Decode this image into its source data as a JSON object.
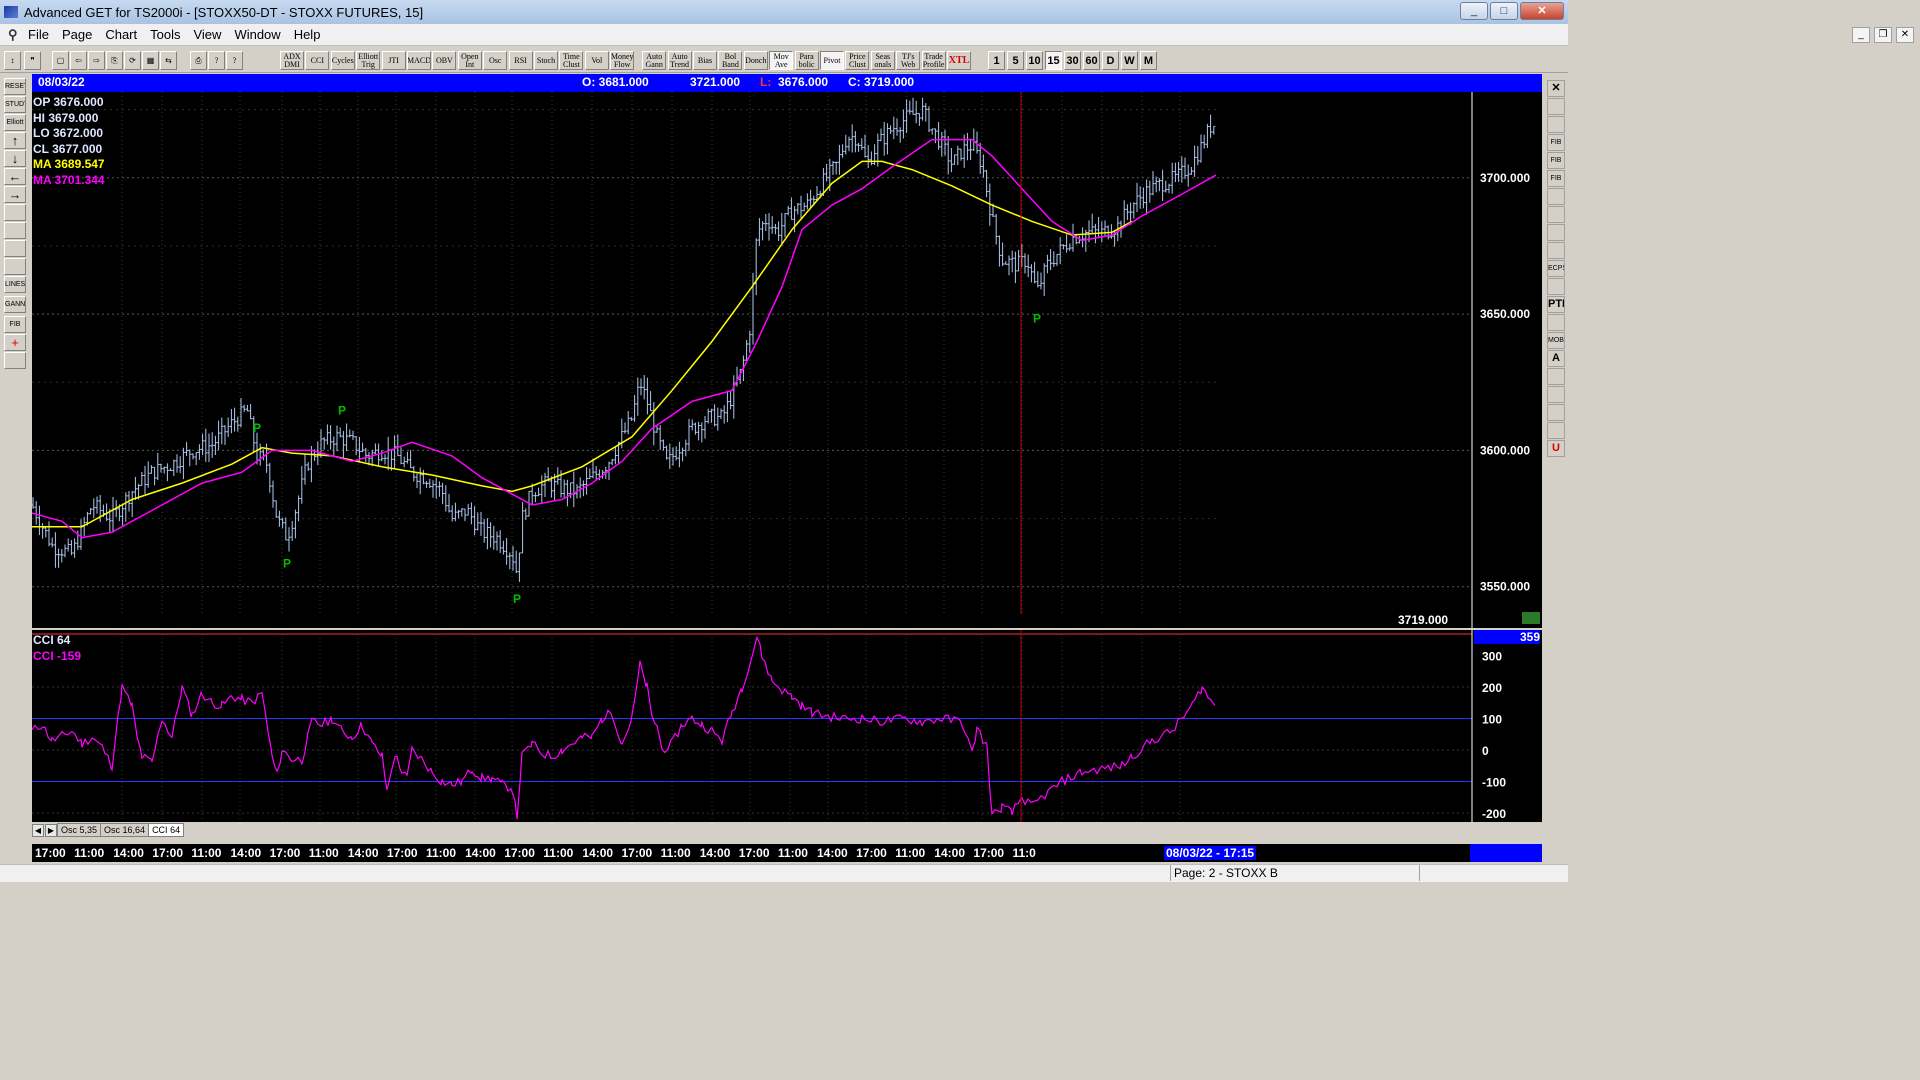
{
  "window": {
    "title": "Advanced GET for TS2000i - [STOXX50-DT - STOXX FUTURES, 15]",
    "minimize": "_",
    "maximize": "□",
    "close": "✕"
  },
  "menu": [
    "File",
    "Page",
    "Chart",
    "Tools",
    "View",
    "Window",
    "Help"
  ],
  "toolbar": {
    "study_buttons": [
      "ADX DMI",
      "CCI",
      "Cycles",
      "Elliott Trig",
      "JTI",
      "MACD",
      "OBV",
      "Open Int",
      "Osc",
      "RSI",
      "Stoch",
      "Time Clust",
      "Vol",
      "Money Flow",
      "Auto Gann",
      "Auto Trend",
      "Bias",
      "Bol Band",
      "Donch",
      "Mov Ave",
      "Para bolic",
      "Pivot",
      "Price Clust",
      "Seas onals",
      "TJ's Web",
      "Trade Profile",
      "XTL"
    ],
    "intervals": [
      "1",
      "5",
      "10",
      "15",
      "30",
      "60",
      "D",
      "W",
      "M"
    ],
    "active_interval": "15"
  },
  "left_tools": [
    "RESET",
    "STUDY",
    "Elliott",
    "↑",
    "↓",
    "←",
    "→",
    "",
    "",
    "",
    "",
    "LINES",
    "GANN",
    "FIB",
    "+",
    ""
  ],
  "right_tools": [
    "✕",
    "",
    "",
    "FIB RET",
    "FIB EXT",
    "FIB TIME",
    "",
    "",
    "",
    "",
    "ECPS",
    "",
    "PTI",
    "",
    "MOB",
    "A",
    "",
    "",
    "",
    "",
    "U"
  ],
  "header": {
    "date": "08/03/22",
    "open": "O: 3681.000",
    "high": "3721.000",
    "low_label": "L:",
    "low": "3676.000",
    "close": "C: 3719.000"
  },
  "cursor_info": {
    "op": "OP  3676.000",
    "hi": "HI   3679.000",
    "lo": "LO   3672.000",
    "cl": "CL   3677.000",
    "ma1": "MA  3689.547",
    "ma2": "MA  3701.344"
  },
  "price_axis": {
    "ticks": [
      "3700.000",
      "3650.000",
      "3600.000",
      "3550.000"
    ],
    "last_price": "3719.000"
  },
  "oscillator": {
    "title": "CCI 64",
    "value_label": "CCI  -159",
    "ticks": [
      "300",
      "200",
      "100",
      "0",
      "-100",
      "-200"
    ],
    "current": "359"
  },
  "pivot_label": "P",
  "osc_tabs": [
    "Osc 5,35",
    "Osc 16,64",
    "CCI 64"
  ],
  "time_axis": [
    "17:00",
    "11:00",
    "14:00",
    "17:00",
    "11:00",
    "14:00",
    "17:00",
    "11:00",
    "14:00",
    "17:00",
    "11:00",
    "14:00",
    "17:00",
    "11:00",
    "14:00",
    "17:00",
    "11:00",
    "14:00",
    "17:00",
    "11:00",
    "14:00",
    "17:00",
    "11:00",
    "14:00",
    "17:00",
    "11:0"
  ],
  "time_cursor": "08/03/22 - 17:15",
  "status": "Page: 2 - STOXX B",
  "colors": {
    "price_bars": "#b0c8f0",
    "ma_fast": "#ffff00",
    "ma_slow": "#ff00ff",
    "pivot": "#00c000",
    "cursor_line": "#c00000",
    "header_bar": "#0000ff"
  },
  "chart_data": {
    "type": "line",
    "title": "STOXX50-DT - STOXX FUTURES, 15",
    "y_range": [
      3540,
      3730
    ],
    "price_path": [
      [
        0,
        3580
      ],
      [
        20,
        3565
      ],
      [
        40,
        3562
      ],
      [
        60,
        3580
      ],
      [
        80,
        3575
      ],
      [
        100,
        3585
      ],
      [
        120,
        3592
      ],
      [
        140,
        3595
      ],
      [
        160,
        3600
      ],
      [
        180,
        3602
      ],
      [
        200,
        3610
      ],
      [
        215,
        3615
      ],
      [
        225,
        3598
      ],
      [
        235,
        3595
      ],
      [
        245,
        3575
      ],
      [
        255,
        3568
      ],
      [
        265,
        3580
      ],
      [
        275,
        3595
      ],
      [
        290,
        3603
      ],
      [
        305,
        3605
      ],
      [
        320,
        3603
      ],
      [
        335,
        3598
      ],
      [
        350,
        3600
      ],
      [
        365,
        3598
      ],
      [
        380,
        3592
      ],
      [
        395,
        3590
      ],
      [
        410,
        3585
      ],
      [
        420,
        3575
      ],
      [
        435,
        3578
      ],
      [
        450,
        3570
      ],
      [
        465,
        3568
      ],
      [
        480,
        3562
      ],
      [
        485,
        3555
      ],
      [
        490,
        3575
      ],
      [
        500,
        3585
      ],
      [
        515,
        3588
      ],
      [
        530,
        3586
      ],
      [
        545,
        3585
      ],
      [
        560,
        3590
      ],
      [
        575,
        3595
      ],
      [
        590,
        3605
      ],
      [
        600,
        3612
      ],
      [
        608,
        3625
      ],
      [
        615,
        3618
      ],
      [
        625,
        3605
      ],
      [
        635,
        3595
      ],
      [
        645,
        3600
      ],
      [
        660,
        3608
      ],
      [
        675,
        3612
      ],
      [
        690,
        3612
      ],
      [
        700,
        3620
      ],
      [
        710,
        3630
      ],
      [
        718,
        3645
      ],
      [
        725,
        3680
      ],
      [
        735,
        3685
      ],
      [
        745,
        3680
      ],
      [
        760,
        3688
      ],
      [
        775,
        3690
      ],
      [
        790,
        3698
      ],
      [
        805,
        3705
      ],
      [
        815,
        3715
      ],
      [
        825,
        3715
      ],
      [
        835,
        3705
      ],
      [
        845,
        3712
      ],
      [
        860,
        3718
      ],
      [
        875,
        3722
      ],
      [
        890,
        3725
      ],
      [
        900,
        3718
      ],
      [
        910,
        3712
      ],
      [
        920,
        3705
      ],
      [
        930,
        3710
      ],
      [
        940,
        3712
      ],
      [
        950,
        3705
      ],
      [
        960,
        3685
      ],
      [
        970,
        3670
      ],
      [
        985,
        3668
      ],
      [
        995,
        3670
      ],
      [
        1005,
        3658
      ],
      [
        1015,
        3668
      ],
      [
        1025,
        3672
      ],
      [
        1040,
        3678
      ],
      [
        1055,
        3680
      ],
      [
        1070,
        3680
      ],
      [
        1085,
        3682
      ],
      [
        1100,
        3690
      ],
      [
        1115,
        3695
      ],
      [
        1130,
        3698
      ],
      [
        1145,
        3700
      ],
      [
        1160,
        3705
      ],
      [
        1170,
        3712
      ],
      [
        1180,
        3720
      ],
      [
        1184,
        3719
      ]
    ],
    "ma_fast": [
      [
        0,
        3572
      ],
      [
        50,
        3572
      ],
      [
        100,
        3582
      ],
      [
        150,
        3588
      ],
      [
        200,
        3595
      ],
      [
        230,
        3601
      ],
      [
        260,
        3599
      ],
      [
        300,
        3598
      ],
      [
        350,
        3594
      ],
      [
        400,
        3591
      ],
      [
        450,
        3587
      ],
      [
        480,
        3585
      ],
      [
        500,
        3587
      ],
      [
        550,
        3594
      ],
      [
        600,
        3605
      ],
      [
        640,
        3622
      ],
      [
        680,
        3640
      ],
      [
        720,
        3660
      ],
      [
        760,
        3681
      ],
      [
        800,
        3698
      ],
      [
        830,
        3706
      ],
      [
        850,
        3706
      ],
      [
        880,
        3703
      ],
      [
        920,
        3697
      ],
      [
        960,
        3690
      ],
      [
        1000,
        3684
      ],
      [
        1040,
        3679
      ],
      [
        1080,
        3680
      ],
      [
        1100,
        3684
      ]
    ],
    "ma_slow": [
      [
        0,
        3577
      ],
      [
        30,
        3574
      ],
      [
        50,
        3568
      ],
      [
        80,
        3570
      ],
      [
        120,
        3578
      ],
      [
        170,
        3588
      ],
      [
        210,
        3592
      ],
      [
        240,
        3600
      ],
      [
        280,
        3600
      ],
      [
        320,
        3596
      ],
      [
        350,
        3599
      ],
      [
        380,
        3603
      ],
      [
        420,
        3598
      ],
      [
        450,
        3590
      ],
      [
        480,
        3584
      ],
      [
        500,
        3580
      ],
      [
        530,
        3582
      ],
      [
        560,
        3588
      ],
      [
        590,
        3596
      ],
      [
        620,
        3608
      ],
      [
        660,
        3618
      ],
      [
        700,
        3622
      ],
      [
        725,
        3640
      ],
      [
        750,
        3660
      ],
      [
        770,
        3681
      ],
      [
        800,
        3690
      ],
      [
        830,
        3696
      ],
      [
        860,
        3704
      ],
      [
        900,
        3714
      ],
      [
        940,
        3714
      ],
      [
        960,
        3708
      ],
      [
        990,
        3696
      ],
      [
        1020,
        3684
      ],
      [
        1050,
        3677
      ],
      [
        1080,
        3679
      ],
      [
        1110,
        3686
      ],
      [
        1150,
        3694
      ],
      [
        1184,
        3701
      ]
    ],
    "cci": [
      [
        0,
        60
      ],
      [
        10,
        80
      ],
      [
        20,
        30
      ],
      [
        30,
        45
      ],
      [
        40,
        60
      ],
      [
        50,
        20
      ],
      [
        60,
        40
      ],
      [
        70,
        10
      ],
      [
        80,
        -50
      ],
      [
        90,
        200
      ],
      [
        100,
        140
      ],
      [
        105,
        40
      ],
      [
        110,
        -20
      ],
      [
        120,
        -40
      ],
      [
        130,
        100
      ],
      [
        140,
        40
      ],
      [
        150,
        200
      ],
      [
        160,
        110
      ],
      [
        170,
        180
      ],
      [
        180,
        150
      ],
      [
        190,
        140
      ],
      [
        200,
        170
      ],
      [
        210,
        160
      ],
      [
        220,
        150
      ],
      [
        230,
        180
      ],
      [
        240,
        -20
      ],
      [
        245,
        -80
      ],
      [
        250,
        0
      ],
      [
        260,
        -30
      ],
      [
        270,
        -30
      ],
      [
        280,
        90
      ],
      [
        290,
        80
      ],
      [
        300,
        100
      ],
      [
        310,
        60
      ],
      [
        320,
        40
      ],
      [
        330,
        80
      ],
      [
        340,
        20
      ],
      [
        350,
        -20
      ],
      [
        355,
        -130
      ],
      [
        360,
        -50
      ],
      [
        365,
        -20
      ],
      [
        370,
        -70
      ],
      [
        375,
        -90
      ],
      [
        380,
        0
      ],
      [
        390,
        -30
      ],
      [
        400,
        -70
      ],
      [
        410,
        -100
      ],
      [
        420,
        -110
      ],
      [
        430,
        -100
      ],
      [
        440,
        -60
      ],
      [
        450,
        -90
      ],
      [
        460,
        -90
      ],
      [
        470,
        -110
      ],
      [
        480,
        -120
      ],
      [
        485,
        -210
      ],
      [
        490,
        -20
      ],
      [
        500,
        20
      ],
      [
        510,
        -10
      ],
      [
        520,
        -20
      ],
      [
        530,
        0
      ],
      [
        540,
        20
      ],
      [
        550,
        40
      ],
      [
        560,
        40
      ],
      [
        570,
        100
      ],
      [
        580,
        120
      ],
      [
        590,
        20
      ],
      [
        600,
        100
      ],
      [
        608,
        270
      ],
      [
        615,
        200
      ],
      [
        620,
        100
      ],
      [
        625,
        80
      ],
      [
        630,
        0
      ],
      [
        640,
        20
      ],
      [
        650,
        80
      ],
      [
        660,
        100
      ],
      [
        670,
        80
      ],
      [
        680,
        60
      ],
      [
        690,
        30
      ],
      [
        700,
        120
      ],
      [
        710,
        200
      ],
      [
        720,
        300
      ],
      [
        725,
        360
      ],
      [
        730,
        300
      ],
      [
        740,
        220
      ],
      [
        750,
        190
      ],
      [
        760,
        170
      ],
      [
        770,
        140
      ],
      [
        780,
        120
      ],
      [
        790,
        110
      ],
      [
        810,
        100
      ],
      [
        830,
        100
      ],
      [
        850,
        90
      ],
      [
        870,
        100
      ],
      [
        890,
        90
      ],
      [
        910,
        100
      ],
      [
        930,
        90
      ],
      [
        940,
        -10
      ],
      [
        945,
        70
      ],
      [
        955,
        10
      ],
      [
        960,
        -210
      ],
      [
        970,
        -180
      ],
      [
        980,
        -200
      ],
      [
        990,
        -150
      ],
      [
        1000,
        -180
      ],
      [
        1010,
        -150
      ],
      [
        1030,
        -100
      ],
      [
        1050,
        -70
      ],
      [
        1070,
        -60
      ],
      [
        1090,
        -50
      ],
      [
        1100,
        -20
      ],
      [
        1120,
        30
      ],
      [
        1140,
        60
      ],
      [
        1160,
        140
      ],
      [
        1170,
        200
      ],
      [
        1180,
        150
      ],
      [
        1184,
        150
      ]
    ],
    "pivots": [
      {
        "x": 225,
        "type": "high"
      },
      {
        "x": 255,
        "type": "low"
      },
      {
        "x": 310,
        "type": "high"
      },
      {
        "x": 485,
        "type": "low"
      },
      {
        "x": 1005,
        "type": "low"
      }
    ]
  }
}
